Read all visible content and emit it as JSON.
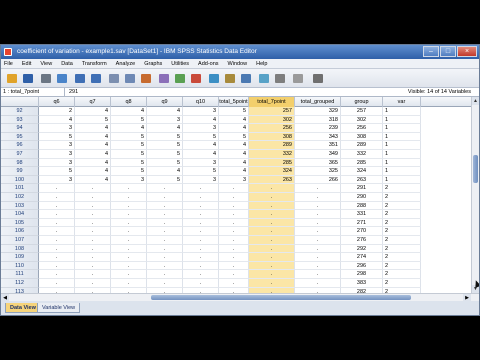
{
  "window": {
    "title": "coefficient of variation - example1.sav [DataSet1] - IBM SPSS Statistics Data Editor",
    "controls": [
      "–",
      "□",
      "×"
    ]
  },
  "menu": [
    "File",
    "Edit",
    "View",
    "Data",
    "Transform",
    "Analyze",
    "Graphs",
    "Utilities",
    "Add-ons",
    "Window",
    "Help"
  ],
  "toolbar": {
    "icons": [
      "open-folder-icon",
      "save-disk-icon",
      "print-icon",
      "dialog-recall-icon",
      "undo-icon",
      "redo-icon",
      "goto-case-icon",
      "goto-variable-icon",
      "variables-icon",
      "find-icon",
      "insert-cases-icon",
      "insert-variable-icon",
      "split-file-icon",
      "weight-cases-icon",
      "select-cases-icon",
      "value-labels-icon",
      "use-sets-icon",
      "show-all-icon",
      "spell-check-icon"
    ],
    "icon_colors": [
      "#e0a32a",
      "#2e5fa8",
      "#6b7684",
      "#4a84c9",
      "#3f6fb5",
      "#3f6fb5",
      "#7c8fb0",
      "#6e89b5",
      "#c76b2f",
      "#8b6fb8",
      "#5aa052",
      "#c94a3a",
      "#3c8fc4",
      "#a78a3b",
      "#4b79b2",
      "#58a2c7",
      "#7e7e7e",
      "#9a9a9a",
      "#6f6f6f"
    ]
  },
  "reference": {
    "cell": "1 : total_7point",
    "value": "291",
    "visible": "Visible: 14 of 14 Variables"
  },
  "columns": [
    "",
    "q6",
    "q7",
    "q8",
    "q9",
    "q10",
    "total_5point",
    "total_7point",
    "total_grouped",
    "group",
    "var"
  ],
  "selected_column": "total_7point",
  "rows": [
    {
      "n": "92",
      "v": [
        "2",
        "4",
        "4",
        "4",
        "3",
        "5",
        "257",
        "329",
        "257",
        "1"
      ]
    },
    {
      "n": "93",
      "v": [
        "4",
        "5",
        "5",
        "3",
        "4",
        "4",
        "302",
        "318",
        "302",
        "1"
      ]
    },
    {
      "n": "94",
      "v": [
        "3",
        "4",
        "4",
        "4",
        "3",
        "4",
        "256",
        "239",
        "256",
        "1"
      ]
    },
    {
      "n": "95",
      "v": [
        "5",
        "4",
        "5",
        "5",
        "5",
        "5",
        "308",
        "343",
        "308",
        "1"
      ]
    },
    {
      "n": "96",
      "v": [
        "3",
        "4",
        "5",
        "5",
        "4",
        "4",
        "289",
        "351",
        "289",
        "1"
      ]
    },
    {
      "n": "97",
      "v": [
        "3",
        "4",
        "5",
        "5",
        "4",
        "4",
        "332",
        "349",
        "332",
        "1"
      ]
    },
    {
      "n": "98",
      "v": [
        "3",
        "4",
        "5",
        "5",
        "3",
        "4",
        "285",
        "365",
        "285",
        "1"
      ]
    },
    {
      "n": "99",
      "v": [
        "5",
        "4",
        "5",
        "4",
        "5",
        "4",
        "324",
        "325",
        "324",
        "1"
      ]
    },
    {
      "n": "100",
      "v": [
        "3",
        "4",
        "3",
        "5",
        "3",
        "3",
        "263",
        "266",
        "263",
        "1"
      ]
    },
    {
      "n": "101",
      "v": [
        "",
        "",
        "",
        "",
        "",
        "",
        "",
        "",
        "291",
        "2"
      ]
    },
    {
      "n": "102",
      "v": [
        "",
        "",
        "",
        "",
        "",
        "",
        "",
        "",
        "290",
        "2"
      ]
    },
    {
      "n": "103",
      "v": [
        "",
        "",
        "",
        "",
        "",
        "",
        "",
        "",
        "288",
        "2"
      ]
    },
    {
      "n": "104",
      "v": [
        "",
        "",
        "",
        "",
        "",
        "",
        "",
        "",
        "331",
        "2"
      ]
    },
    {
      "n": "105",
      "v": [
        "",
        "",
        "",
        "",
        "",
        "",
        "",
        "",
        "271",
        "2"
      ]
    },
    {
      "n": "106",
      "v": [
        "",
        "",
        "",
        "",
        "",
        "",
        "",
        "",
        "270",
        "2"
      ]
    },
    {
      "n": "107",
      "v": [
        "",
        "",
        "",
        "",
        "",
        "",
        "",
        "",
        "276",
        "2"
      ]
    },
    {
      "n": "108",
      "v": [
        "",
        "",
        "",
        "",
        "",
        "",
        "",
        "",
        "292",
        "2"
      ]
    },
    {
      "n": "109",
      "v": [
        "",
        "",
        "",
        "",
        "",
        "",
        "",
        "",
        "274",
        "2"
      ]
    },
    {
      "n": "110",
      "v": [
        "",
        "",
        "",
        "",
        "",
        "",
        "",
        "",
        "296",
        "2"
      ]
    },
    {
      "n": "111",
      "v": [
        "",
        "",
        "",
        "",
        "",
        "",
        "",
        "",
        "298",
        "2"
      ]
    },
    {
      "n": "112",
      "v": [
        "",
        "",
        "",
        "",
        "",
        "",
        "",
        "",
        "383",
        "2"
      ]
    },
    {
      "n": "113",
      "v": [
        "",
        "",
        "",
        "",
        "",
        "",
        "",
        "",
        "282",
        "2"
      ]
    }
  ],
  "tabs": [
    {
      "label": "Data View",
      "active": true
    },
    {
      "label": "Variable View",
      "active": false
    }
  ],
  "colors": {
    "selected_column": "#f3cf6c",
    "selected_cell": "#fbe6a6",
    "title_bar": "#2e5fa8",
    "row_header_text": "#1d3c78"
  }
}
